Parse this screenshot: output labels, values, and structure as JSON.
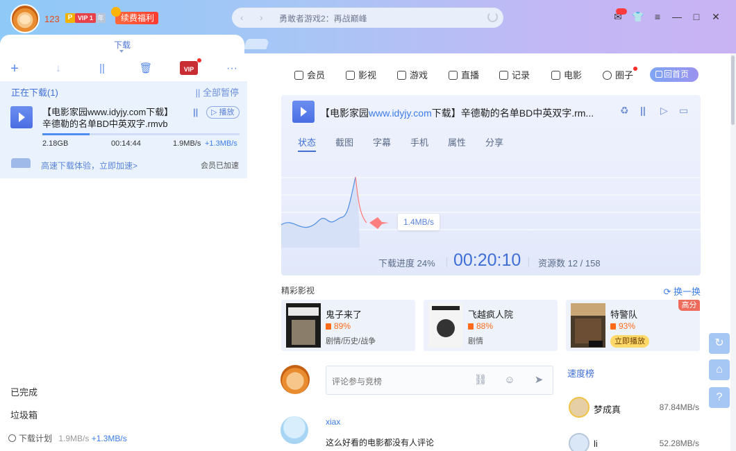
{
  "user": {
    "name": "123",
    "p_badge": "P",
    "vip_badge": "VIP 1",
    "year_badge": "年",
    "renew": "续费福利"
  },
  "search": {
    "text": "勇敢者游戏2：再战巅峰",
    "back": "‹",
    "forward": "›"
  },
  "window": {
    "msg": "✉",
    "skin": "👕",
    "menu": "≡",
    "min": "—",
    "max": "□",
    "close": "✕"
  },
  "left": {
    "tab": "下载",
    "toolbar": {
      "add": "+",
      "down": "↓",
      "pause": "||",
      "delete": "🗑",
      "vip": "VIP",
      "more": "···"
    },
    "active_header": "正在下载(1)",
    "pause_all": "|| 全部暂停",
    "item": {
      "title": "【电影家园www.idyjy.com下载】辛德勒的名单BD中英双字.rmvb",
      "pause": "||",
      "play": "▷ 播放",
      "size": "2.18GB",
      "time": "00:14:44",
      "speed": "1.9MB/s",
      "accel": "+1.3MB/s",
      "progress": 0.24,
      "accel_link": "高速下载体验，立即加速>",
      "member": "会员已加速"
    },
    "completed": "已完成",
    "trash": "垃圾箱",
    "plan": {
      "label": "下载计划",
      "speed": "1.9MB/s",
      "accel": "+1.3MB/s"
    }
  },
  "right": {
    "nav": [
      "会员",
      "影视",
      "游戏",
      "直播",
      "记录",
      "电影",
      "圈子"
    ],
    "home": "回首页",
    "card": {
      "title_prefix": "【电影家园",
      "title_url": "www.idyjy.com",
      "title_suffix": "下载】辛德勒的名单BD中英双字.rm...",
      "subtabs": [
        "状态",
        "截图",
        "字幕",
        "手机",
        "属性",
        "分享"
      ],
      "speed_tip": "1.4MB/s",
      "progress_label": "下载进度 24%",
      "elapsed": "00:20:10",
      "sources": "资源数 12 / 158"
    },
    "section_title": "精彩影视",
    "refresh": "⟳ 换一换",
    "movies": [
      {
        "name": "鬼子来了",
        "score": "89%",
        "genre": "剧情/历史/战争"
      },
      {
        "name": "飞越疯人院",
        "score": "88%",
        "genre": "剧情"
      },
      {
        "name": "特警队",
        "score": "93%",
        "tag": "高分",
        "action": "立即播放"
      }
    ],
    "comment_placeholder": "评论参与竞榜",
    "rank_title": "速度榜",
    "ranks": [
      {
        "name": "梦成真",
        "speed": "87.84MB/s"
      },
      {
        "name": "li",
        "speed": "52.28MB/s"
      }
    ],
    "comment": {
      "user": "xiax",
      "text": "这么好看的电影都没有人评论"
    }
  },
  "colors": {
    "accent": "#3f6fd6",
    "link": "#3c7de8",
    "warning": "#ff6b1a"
  }
}
